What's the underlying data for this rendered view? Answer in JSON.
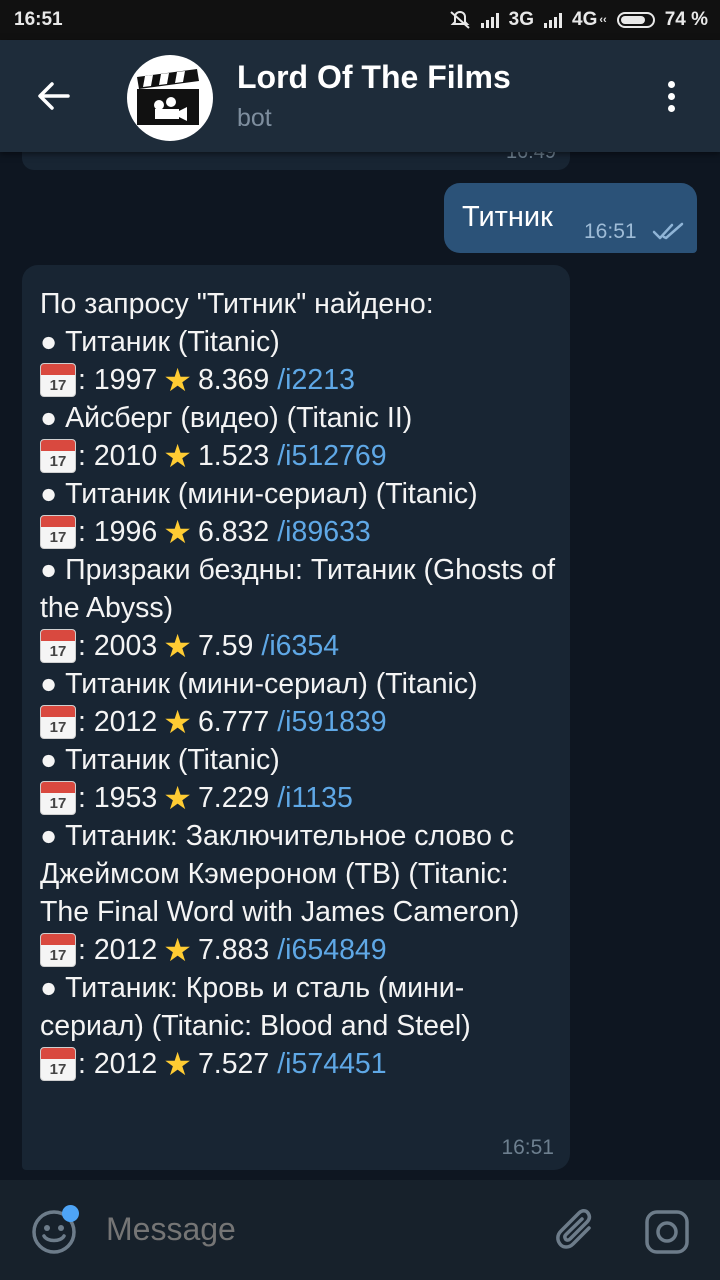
{
  "status_bar": {
    "time": "16:51",
    "network_1": "3G",
    "network_2": "4G",
    "network_2_sub": "‹‹",
    "battery": "74 %"
  },
  "header": {
    "title": "Lord Of The Films",
    "subtitle": "bot",
    "accent": "#1e2c3a"
  },
  "chat": {
    "previous_time": "16:49",
    "outgoing": {
      "text": "Титник",
      "time": "16:51"
    },
    "incoming": {
      "time": "16:51",
      "intro": "По запросу \"Титник\" найдено:",
      "results": [
        {
          "title": "● Титаник (Titanic)",
          "year": ": 1997",
          "rating": "8.369",
          "link": "/i2213"
        },
        {
          "title": "● Айсберг (видео) (Titanic II)",
          "year": ": 2010",
          "rating": "1.523",
          "link": "/i512769"
        },
        {
          "title": "● Титаник (мини-сериал) (Titanic)",
          "year": ": 1996",
          "rating": "6.832",
          "link": "/i89633"
        },
        {
          "title": "● Призраки бездны: Титаник (Ghosts of the Abyss)",
          "year": ": 2003",
          "rating": "7.59",
          "link": "/i6354"
        },
        {
          "title": "● Титаник (мини-сериал) (Titanic)",
          "year": ": 2012",
          "rating": "6.777",
          "link": "/i591839"
        },
        {
          "title": "● Титаник (Titanic)",
          "year": ": 1953",
          "rating": "7.229",
          "link": "/i1135"
        },
        {
          "title": "● Титаник: Заключительное слово с Джеймсом Кэмероном (ТВ) (Titanic: The Final Word with James Cameron)",
          "year": ": 2012",
          "rating": "7.883",
          "link": "/i654849"
        },
        {
          "title": "● Титаник: Кровь и сталь (мини-сериал) (Titanic: Blood and Steel)",
          "year": ": 2012",
          "rating": "7.527",
          "link": "/i574451"
        }
      ],
      "calendar_icon": {
        "month": "JUL",
        "day": "17"
      },
      "star_icon": "star-icon"
    }
  },
  "input": {
    "placeholder": "Message"
  },
  "colors": {
    "background": "#0e1621",
    "outgoing_bubble": "#2b5278",
    "incoming_bubble": "#182533",
    "link": "#5fa8e6"
  }
}
